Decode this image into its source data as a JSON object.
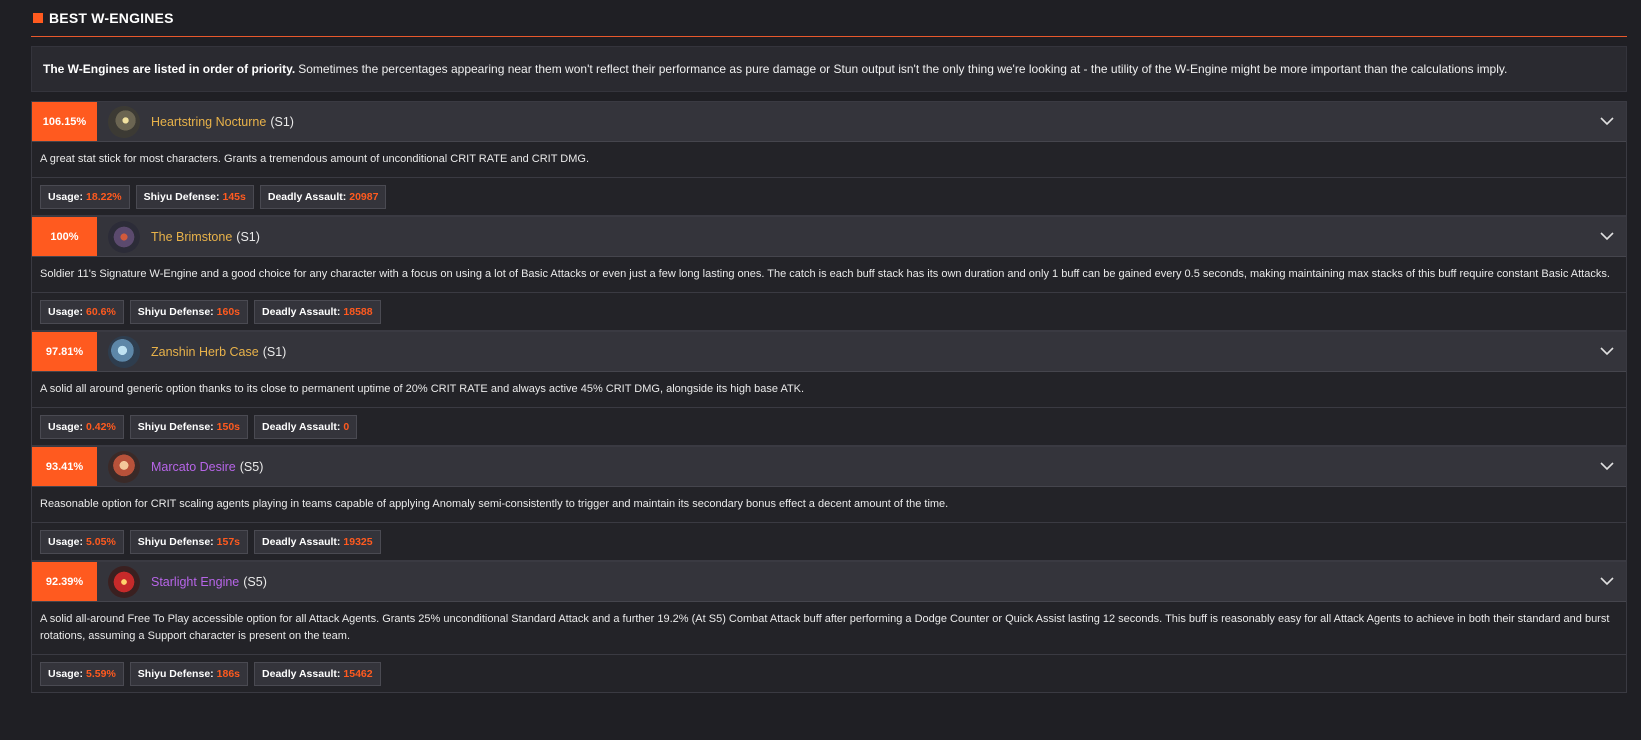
{
  "section": {
    "title": "BEST W-ENGINES"
  },
  "intro": {
    "bold": "The W-Engines are listed in order of priority.",
    "text": "Sometimes the percentages appearing near them won't reflect their performance as pure damage or Stun output isn't the only thing we're looking at - the utility of the W-Engine might be more important than the calculations imply."
  },
  "colors": {
    "accent": "#ff5a1f",
    "gold": "#e8b24a",
    "purple": "#b765e8"
  },
  "engines": [
    {
      "percent": "106.15%",
      "name": "Heartstring Nocturne",
      "rank": "(S1)",
      "name_color": "#e8b24a",
      "icon": "heartstring-nocturne-icon",
      "description": "A great stat stick for most characters. Grants a tremendous amount of unconditional CRIT RATE and CRIT DMG.",
      "stats": {
        "usage_label": "Usage:",
        "usage": "18.22%",
        "shiyu_label": "Shiyu Defense:",
        "shiyu": "145s",
        "deadly_label": "Deadly Assault:",
        "deadly": "20987"
      }
    },
    {
      "percent": "100%",
      "name": "The Brimstone",
      "rank": "(S1)",
      "name_color": "#e8b24a",
      "icon": "the-brimstone-icon",
      "description": "Soldier 11's Signature W-Engine and a good choice for any character with a focus on using a lot of Basic Attacks or even just a few long lasting ones. The catch is each buff stack has its own duration and only 1 buff can be gained every 0.5 seconds, making maintaining max stacks of this buff require constant Basic Attacks.",
      "stats": {
        "usage_label": "Usage:",
        "usage": "60.6%",
        "shiyu_label": "Shiyu Defense:",
        "shiyu": "160s",
        "deadly_label": "Deadly Assault:",
        "deadly": "18588"
      }
    },
    {
      "percent": "97.81%",
      "name": "Zanshin Herb Case",
      "rank": "(S1)",
      "name_color": "#e8b24a",
      "icon": "zanshin-herb-case-icon",
      "description": "A solid all around generic option thanks to its close to permanent uptime of 20% CRIT RATE and always active 45% CRIT DMG, alongside its high base ATK.",
      "stats": {
        "usage_label": "Usage:",
        "usage": "0.42%",
        "shiyu_label": "Shiyu Defense:",
        "shiyu": "150s",
        "deadly_label": "Deadly Assault:",
        "deadly": "0"
      }
    },
    {
      "percent": "93.41%",
      "name": "Marcato Desire",
      "rank": "(S5)",
      "name_color": "#b765e8",
      "icon": "marcato-desire-icon",
      "description": "Reasonable option for CRIT scaling agents playing in teams capable of applying Anomaly semi-consistently to trigger and maintain its secondary bonus effect a decent amount of the time.",
      "stats": {
        "usage_label": "Usage:",
        "usage": "5.05%",
        "shiyu_label": "Shiyu Defense:",
        "shiyu": "157s",
        "deadly_label": "Deadly Assault:",
        "deadly": "19325"
      }
    },
    {
      "percent": "92.39%",
      "name": "Starlight Engine",
      "rank": "(S5)",
      "name_color": "#b765e8",
      "icon": "starlight-engine-icon",
      "description": "A solid all-around Free To Play accessible option for all Attack Agents. Grants 25% unconditional Standard Attack and a further 19.2% (At S5) Combat Attack buff after performing a Dodge Counter or Quick Assist lasting 12 seconds. This buff is reasonably easy for all Attack Agents to achieve in both their standard and burst rotations, assuming a Support character is present on the team.",
      "stats": {
        "usage_label": "Usage:",
        "usage": "5.59%",
        "shiyu_label": "Shiyu Defense:",
        "shiyu": "186s",
        "deadly_label": "Deadly Assault:",
        "deadly": "15462"
      }
    }
  ]
}
